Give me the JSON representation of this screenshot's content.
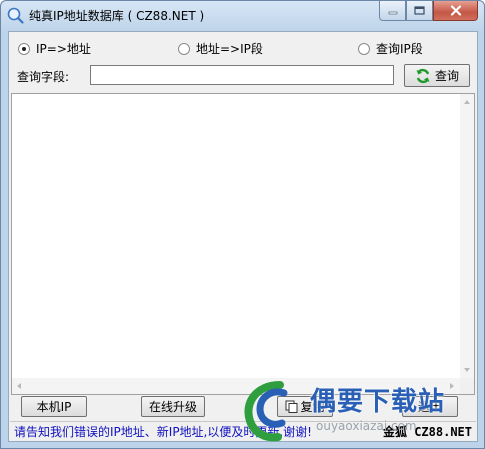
{
  "window": {
    "title": "纯真IP地址数据库 ( CZ88.NET )"
  },
  "mode": {
    "options": [
      {
        "label": "IP=>地址",
        "selected": true
      },
      {
        "label": "地址=>IP段",
        "selected": false
      },
      {
        "label": "查询IP段",
        "selected": false
      }
    ]
  },
  "query": {
    "label": "查询字段:",
    "value": "",
    "button_label": "查询",
    "button_icon": "refresh-icon"
  },
  "buttons": {
    "local_ip": "本机IP",
    "upgrade": "在线升级",
    "copy": "复制",
    "exit": "退出"
  },
  "status": {
    "message": "请告知我们错误的IP地址、新IP地址,以便及时更新,谢谢!",
    "site": "金狐 CZ88.NET"
  },
  "watermark": {
    "text": "偶要下载站",
    "sub": "ouyaoxiazai.com"
  },
  "colors": {
    "accent": "#1010c0",
    "title_bg": "#bed4ea",
    "close_button": "#c45746",
    "watermark": "#2a5fb6"
  }
}
